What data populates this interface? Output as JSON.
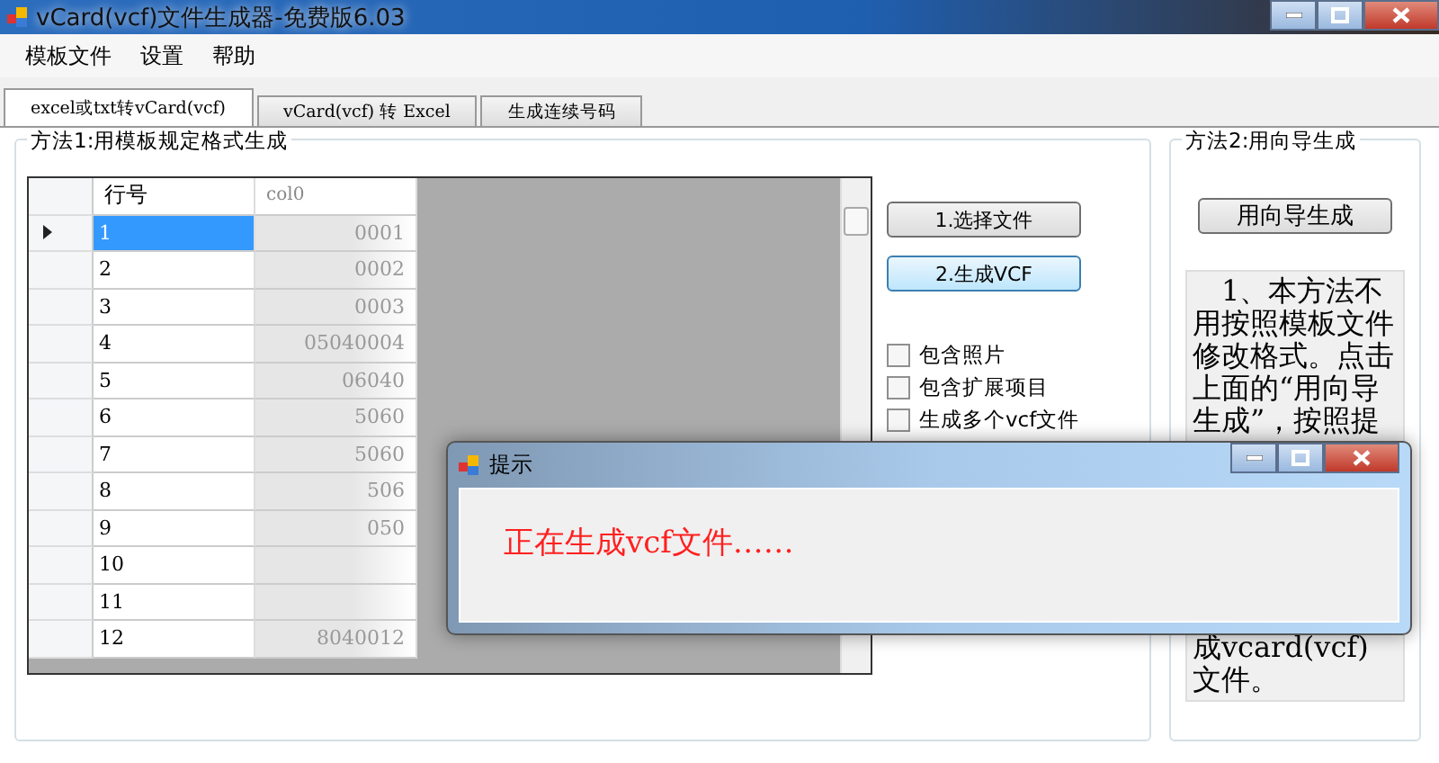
{
  "window": {
    "title": "vCard(vcf)文件生成器-免费版6.03"
  },
  "menu": [
    "模板文件",
    "设置",
    "帮助"
  ],
  "tabs": [
    {
      "label": "excel或txt转vCard(vcf)",
      "selected": true
    },
    {
      "label": "vCard(vcf) 转 Excel",
      "selected": false
    },
    {
      "label": "生成连续号码",
      "selected": false
    }
  ],
  "method1": {
    "title": "方法1:用模板规定格式生成",
    "grid": {
      "columns": [
        "行号",
        "col0"
      ],
      "rows": [
        {
          "no": "1",
          "value": "0001",
          "current": true
        },
        {
          "no": "2",
          "value": "0002",
          "current": false
        },
        {
          "no": "3",
          "value": "0003",
          "current": false
        },
        {
          "no": "4",
          "value": "05040004",
          "current": false
        },
        {
          "no": "5",
          "value": "06040",
          "current": false
        },
        {
          "no": "6",
          "value": "5060",
          "current": false
        },
        {
          "no": "7",
          "value": "5060",
          "current": false
        },
        {
          "no": "8",
          "value": "506",
          "current": false
        },
        {
          "no": "9",
          "value": "050",
          "current": false
        },
        {
          "no": "10",
          "value": "",
          "current": false
        },
        {
          "no": "11",
          "value": "",
          "current": false
        },
        {
          "no": "12",
          "value": "8040012",
          "current": false
        }
      ]
    },
    "buttons": [
      {
        "label": "1.选择文件",
        "selected": false
      },
      {
        "label": "2.生成VCF",
        "selected": true
      }
    ],
    "options": [
      {
        "label": "包含照片",
        "checked": false
      },
      {
        "label": "包含扩展项目",
        "checked": false
      },
      {
        "label": "生成多个vcf文件",
        "checked": false
      }
    ]
  },
  "method2": {
    "title": "方法2:用向导生成",
    "button": "用向导生成",
    "help_lines_top": [
      "　1、本方法不",
      "用按照模板文件",
      "修改格式。点击",
      "上面的“用向导",
      "生成”，按照提"
    ],
    "help_lines_bottom": [
      "成vcard(vcf)",
      "文件。"
    ]
  },
  "dialog": {
    "title": "提示",
    "message": "正在生成vcf文件……"
  }
}
